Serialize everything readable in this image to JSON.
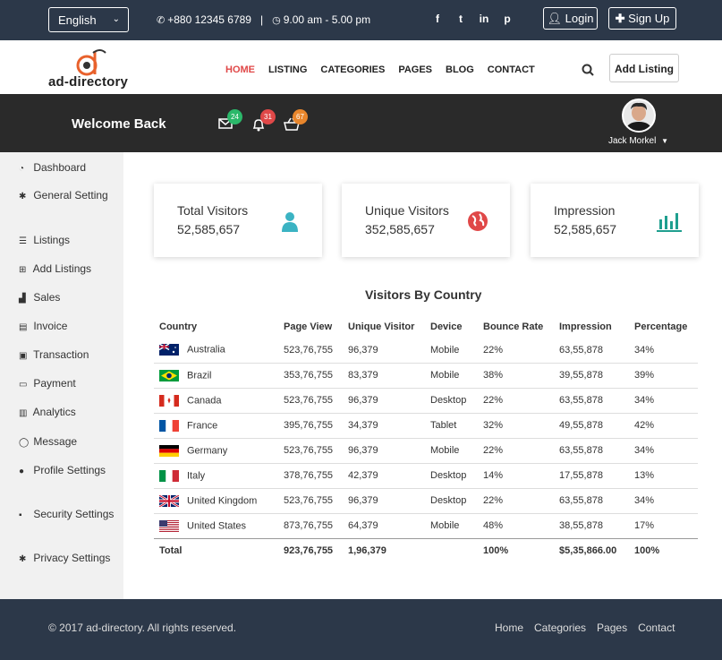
{
  "topbar": {
    "language": "English",
    "phone": "+880 12345 6789",
    "separator": "|",
    "hours": "9.00 am - 5.00 pm",
    "social": [
      "f",
      "t",
      "in",
      "p"
    ],
    "login_label": "Login",
    "signup_label": "Sign Up"
  },
  "header": {
    "logo_text": "ad-directory",
    "nav": [
      "HOME",
      "LISTING",
      "CATEGORIES",
      "PAGES",
      "BLOG",
      "CONTACT"
    ],
    "add_listing": "Add Listing"
  },
  "welcome": {
    "title": "Welcome Back",
    "mail_count": "24",
    "bell_count": "31",
    "cart_count": "67",
    "user_name": "Jack Morkel"
  },
  "sidebar": {
    "items": [
      {
        "label": "Dashboard",
        "icon": "dashboard-icon"
      },
      {
        "label": "General Setting",
        "icon": "gear-icon"
      },
      {
        "label": "Listings",
        "icon": "list-icon"
      },
      {
        "label": "Add Listings",
        "icon": "plus-square-icon"
      },
      {
        "label": "Sales",
        "icon": "cart-icon"
      },
      {
        "label": "Invoice",
        "icon": "file-icon"
      },
      {
        "label": "Transaction",
        "icon": "money-icon"
      },
      {
        "label": "Payment",
        "icon": "credit-card-icon"
      },
      {
        "label": "Analytics",
        "icon": "bar-chart-icon"
      },
      {
        "label": "Message",
        "icon": "comment-icon"
      },
      {
        "label": "Profile Settings",
        "icon": "user-icon"
      },
      {
        "label": "Security Settings",
        "icon": "lock-icon"
      },
      {
        "label": "Privacy Settings",
        "icon": "gear-icon"
      }
    ]
  },
  "stats": [
    {
      "label": "Total Visitors",
      "value": "52,585,657",
      "icon": "user-icon",
      "color": "#3bb3c3"
    },
    {
      "label": "Unique Visitors",
      "value": "352,585,657",
      "icon": "globe-icon",
      "color": "#e04848"
    },
    {
      "label": "Impression",
      "value": "52,585,657",
      "icon": "bar-chart-icon",
      "color": "#1f9f8f"
    }
  ],
  "table": {
    "title": "Visitors By Country",
    "columns": [
      "Country",
      "Page View",
      "Unique Visitor",
      "Device",
      "Bounce Rate",
      "Impression",
      "Percentage"
    ],
    "rows": [
      [
        "Australia",
        "523,76,755",
        "96,379",
        "Mobile",
        "22%",
        "63,55,878",
        "34%"
      ],
      [
        "Brazil",
        "353,76,755",
        "83,379",
        "Mobile",
        "38%",
        "39,55,878",
        "39%"
      ],
      [
        "Canada",
        "523,76,755",
        "96,379",
        "Desktop",
        "22%",
        "63,55,878",
        "34%"
      ],
      [
        "France",
        "395,76,755",
        "34,379",
        "Tablet",
        "32%",
        "49,55,878",
        "42%"
      ],
      [
        "Germany",
        "523,76,755",
        "96,379",
        "Mobile",
        "22%",
        "63,55,878",
        "34%"
      ],
      [
        "Italy",
        "378,76,755",
        "42,379",
        "Desktop",
        "14%",
        "17,55,878",
        "13%"
      ],
      [
        "United Kingdom",
        "523,76,755",
        "96,379",
        "Desktop",
        "22%",
        "63,55,878",
        "34%"
      ],
      [
        "United States",
        "873,76,755",
        "64,379",
        "Mobile",
        "48%",
        "38,55,878",
        "17%"
      ]
    ],
    "total": [
      "Total",
      "923,76,755",
      "1,96,379",
      "",
      "100%",
      "$5,35,866.00",
      "100%"
    ]
  },
  "footer": {
    "copyright": "© 2017 ad-directory. All rights reserved.",
    "links": [
      "Home",
      "Categories",
      "Pages",
      "Contact"
    ]
  }
}
